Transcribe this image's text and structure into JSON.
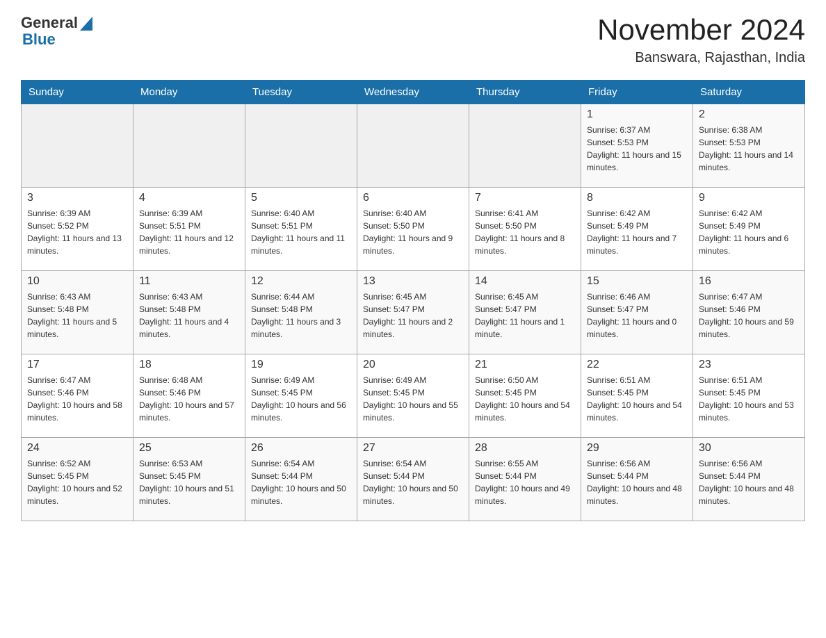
{
  "logo": {
    "general": "General",
    "blue": "Blue"
  },
  "title": "November 2024",
  "subtitle": "Banswara, Rajasthan, India",
  "days_of_week": [
    "Sunday",
    "Monday",
    "Tuesday",
    "Wednesday",
    "Thursday",
    "Friday",
    "Saturday"
  ],
  "weeks": [
    {
      "days": [
        {
          "number": "",
          "sunrise": "",
          "sunset": "",
          "daylight": "",
          "empty": true
        },
        {
          "number": "",
          "sunrise": "",
          "sunset": "",
          "daylight": "",
          "empty": true
        },
        {
          "number": "",
          "sunrise": "",
          "sunset": "",
          "daylight": "",
          "empty": true
        },
        {
          "number": "",
          "sunrise": "",
          "sunset": "",
          "daylight": "",
          "empty": true
        },
        {
          "number": "",
          "sunrise": "",
          "sunset": "",
          "daylight": "",
          "empty": true
        },
        {
          "number": "1",
          "sunrise": "Sunrise: 6:37 AM",
          "sunset": "Sunset: 5:53 PM",
          "daylight": "Daylight: 11 hours and 15 minutes.",
          "empty": false
        },
        {
          "number": "2",
          "sunrise": "Sunrise: 6:38 AM",
          "sunset": "Sunset: 5:53 PM",
          "daylight": "Daylight: 11 hours and 14 minutes.",
          "empty": false
        }
      ]
    },
    {
      "days": [
        {
          "number": "3",
          "sunrise": "Sunrise: 6:39 AM",
          "sunset": "Sunset: 5:52 PM",
          "daylight": "Daylight: 11 hours and 13 minutes.",
          "empty": false
        },
        {
          "number": "4",
          "sunrise": "Sunrise: 6:39 AM",
          "sunset": "Sunset: 5:51 PM",
          "daylight": "Daylight: 11 hours and 12 minutes.",
          "empty": false
        },
        {
          "number": "5",
          "sunrise": "Sunrise: 6:40 AM",
          "sunset": "Sunset: 5:51 PM",
          "daylight": "Daylight: 11 hours and 11 minutes.",
          "empty": false
        },
        {
          "number": "6",
          "sunrise": "Sunrise: 6:40 AM",
          "sunset": "Sunset: 5:50 PM",
          "daylight": "Daylight: 11 hours and 9 minutes.",
          "empty": false
        },
        {
          "number": "7",
          "sunrise": "Sunrise: 6:41 AM",
          "sunset": "Sunset: 5:50 PM",
          "daylight": "Daylight: 11 hours and 8 minutes.",
          "empty": false
        },
        {
          "number": "8",
          "sunrise": "Sunrise: 6:42 AM",
          "sunset": "Sunset: 5:49 PM",
          "daylight": "Daylight: 11 hours and 7 minutes.",
          "empty": false
        },
        {
          "number": "9",
          "sunrise": "Sunrise: 6:42 AM",
          "sunset": "Sunset: 5:49 PM",
          "daylight": "Daylight: 11 hours and 6 minutes.",
          "empty": false
        }
      ]
    },
    {
      "days": [
        {
          "number": "10",
          "sunrise": "Sunrise: 6:43 AM",
          "sunset": "Sunset: 5:48 PM",
          "daylight": "Daylight: 11 hours and 5 minutes.",
          "empty": false
        },
        {
          "number": "11",
          "sunrise": "Sunrise: 6:43 AM",
          "sunset": "Sunset: 5:48 PM",
          "daylight": "Daylight: 11 hours and 4 minutes.",
          "empty": false
        },
        {
          "number": "12",
          "sunrise": "Sunrise: 6:44 AM",
          "sunset": "Sunset: 5:48 PM",
          "daylight": "Daylight: 11 hours and 3 minutes.",
          "empty": false
        },
        {
          "number": "13",
          "sunrise": "Sunrise: 6:45 AM",
          "sunset": "Sunset: 5:47 PM",
          "daylight": "Daylight: 11 hours and 2 minutes.",
          "empty": false
        },
        {
          "number": "14",
          "sunrise": "Sunrise: 6:45 AM",
          "sunset": "Sunset: 5:47 PM",
          "daylight": "Daylight: 11 hours and 1 minute.",
          "empty": false
        },
        {
          "number": "15",
          "sunrise": "Sunrise: 6:46 AM",
          "sunset": "Sunset: 5:47 PM",
          "daylight": "Daylight: 11 hours and 0 minutes.",
          "empty": false
        },
        {
          "number": "16",
          "sunrise": "Sunrise: 6:47 AM",
          "sunset": "Sunset: 5:46 PM",
          "daylight": "Daylight: 10 hours and 59 minutes.",
          "empty": false
        }
      ]
    },
    {
      "days": [
        {
          "number": "17",
          "sunrise": "Sunrise: 6:47 AM",
          "sunset": "Sunset: 5:46 PM",
          "daylight": "Daylight: 10 hours and 58 minutes.",
          "empty": false
        },
        {
          "number": "18",
          "sunrise": "Sunrise: 6:48 AM",
          "sunset": "Sunset: 5:46 PM",
          "daylight": "Daylight: 10 hours and 57 minutes.",
          "empty": false
        },
        {
          "number": "19",
          "sunrise": "Sunrise: 6:49 AM",
          "sunset": "Sunset: 5:45 PM",
          "daylight": "Daylight: 10 hours and 56 minutes.",
          "empty": false
        },
        {
          "number": "20",
          "sunrise": "Sunrise: 6:49 AM",
          "sunset": "Sunset: 5:45 PM",
          "daylight": "Daylight: 10 hours and 55 minutes.",
          "empty": false
        },
        {
          "number": "21",
          "sunrise": "Sunrise: 6:50 AM",
          "sunset": "Sunset: 5:45 PM",
          "daylight": "Daylight: 10 hours and 54 minutes.",
          "empty": false
        },
        {
          "number": "22",
          "sunrise": "Sunrise: 6:51 AM",
          "sunset": "Sunset: 5:45 PM",
          "daylight": "Daylight: 10 hours and 54 minutes.",
          "empty": false
        },
        {
          "number": "23",
          "sunrise": "Sunrise: 6:51 AM",
          "sunset": "Sunset: 5:45 PM",
          "daylight": "Daylight: 10 hours and 53 minutes.",
          "empty": false
        }
      ]
    },
    {
      "days": [
        {
          "number": "24",
          "sunrise": "Sunrise: 6:52 AM",
          "sunset": "Sunset: 5:45 PM",
          "daylight": "Daylight: 10 hours and 52 minutes.",
          "empty": false
        },
        {
          "number": "25",
          "sunrise": "Sunrise: 6:53 AM",
          "sunset": "Sunset: 5:45 PM",
          "daylight": "Daylight: 10 hours and 51 minutes.",
          "empty": false
        },
        {
          "number": "26",
          "sunrise": "Sunrise: 6:54 AM",
          "sunset": "Sunset: 5:44 PM",
          "daylight": "Daylight: 10 hours and 50 minutes.",
          "empty": false
        },
        {
          "number": "27",
          "sunrise": "Sunrise: 6:54 AM",
          "sunset": "Sunset: 5:44 PM",
          "daylight": "Daylight: 10 hours and 50 minutes.",
          "empty": false
        },
        {
          "number": "28",
          "sunrise": "Sunrise: 6:55 AM",
          "sunset": "Sunset: 5:44 PM",
          "daylight": "Daylight: 10 hours and 49 minutes.",
          "empty": false
        },
        {
          "number": "29",
          "sunrise": "Sunrise: 6:56 AM",
          "sunset": "Sunset: 5:44 PM",
          "daylight": "Daylight: 10 hours and 48 minutes.",
          "empty": false
        },
        {
          "number": "30",
          "sunrise": "Sunrise: 6:56 AM",
          "sunset": "Sunset: 5:44 PM",
          "daylight": "Daylight: 10 hours and 48 minutes.",
          "empty": false
        }
      ]
    }
  ]
}
